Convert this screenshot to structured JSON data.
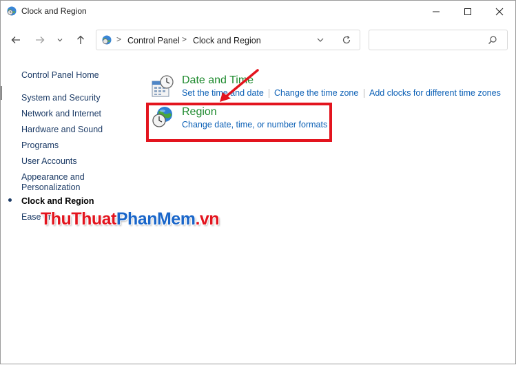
{
  "window": {
    "title": "Clock and Region",
    "minimize_icon": "minimize-icon",
    "maximize_icon": "maximize-icon",
    "close_icon": "close-icon"
  },
  "address": {
    "crumbs": [
      "Control Panel",
      "Clock and Region"
    ],
    "separator": ">",
    "search_placeholder": ""
  },
  "sidebar": {
    "home": "Control Panel Home",
    "items": [
      {
        "label": "System and Security"
      },
      {
        "label": "Network and Internet"
      },
      {
        "label": "Hardware and Sound"
      },
      {
        "label": "Programs"
      },
      {
        "label": "User Accounts"
      },
      {
        "label": "Appearance and"
      },
      {
        "label": "Personalization"
      },
      {
        "label": "Clock and Region",
        "active": true
      },
      {
        "label": "Ease of"
      }
    ]
  },
  "categories": [
    {
      "title": "Date and Time",
      "icon": "calendar-clock-icon",
      "links": [
        "Set the time and date",
        "Change the time zone",
        "Add clocks for different time zones"
      ]
    },
    {
      "title": "Region",
      "icon": "globe-clock-icon",
      "links": [
        "Change date, time, or number formats"
      ]
    }
  ],
  "watermark": {
    "part1": "ThuThuat",
    "part2": "PhanMem",
    "part3": ".vn"
  },
  "colors": {
    "accent": "#0a5fb5",
    "category_title": "#1e8a2e",
    "highlight": "#e3141e",
    "sidebar_link": "#1c3b66"
  }
}
